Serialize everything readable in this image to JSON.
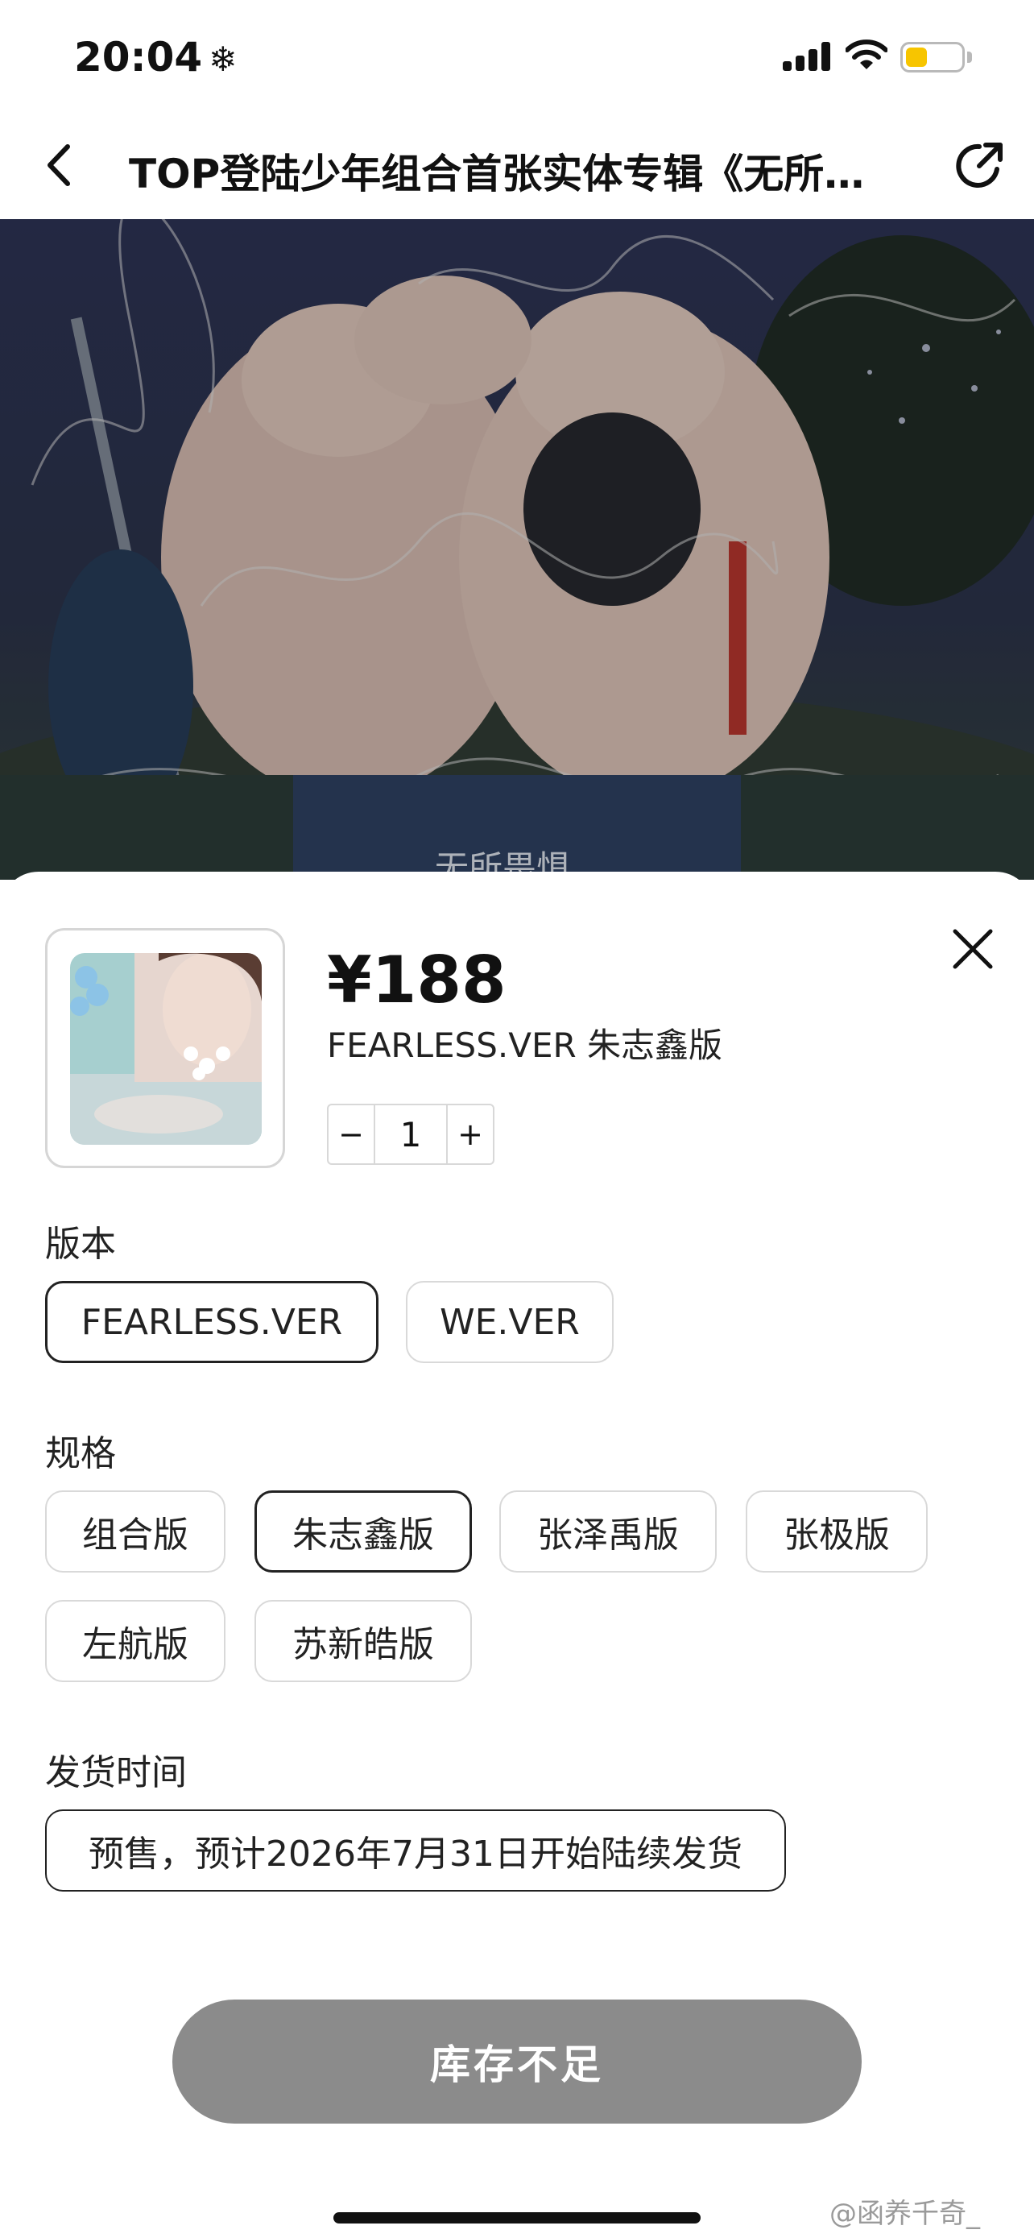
{
  "status": {
    "time": "20:04",
    "extra_icon": "snowflake-icon",
    "battery_level": 0.4
  },
  "nav": {
    "title": "TOP登陆少年组合首张实体专辑《无所…"
  },
  "hero": {
    "album_logo_text": "无所畏惧"
  },
  "product": {
    "price": "¥188",
    "variant": "FEARLESS.VER 朱志鑫版",
    "quantity": "1",
    "minus": "−",
    "plus": "+"
  },
  "version": {
    "label": "版本",
    "options": [
      {
        "label": "FEARLESS.VER",
        "selected": true
      },
      {
        "label": "WE.VER",
        "selected": false
      }
    ]
  },
  "spec": {
    "label": "规格",
    "options": [
      {
        "label": "组合版",
        "selected": false
      },
      {
        "label": "朱志鑫版",
        "selected": true
      },
      {
        "label": "张泽禹版",
        "selected": false
      },
      {
        "label": "张极版",
        "selected": false
      },
      {
        "label": "左航版",
        "selected": false
      },
      {
        "label": "苏新皓版",
        "selected": false
      }
    ]
  },
  "shipping": {
    "label": "发货时间",
    "option": "预售，预计2026年7月31日开始陆续发货"
  },
  "cta": {
    "label": "库存不足"
  },
  "watermark": {
    "text": "@函养千奇_"
  },
  "colors": {
    "cta_bg": "#8b8b8b",
    "hero_bg": "#2c3350",
    "battery": "#f7c500"
  }
}
